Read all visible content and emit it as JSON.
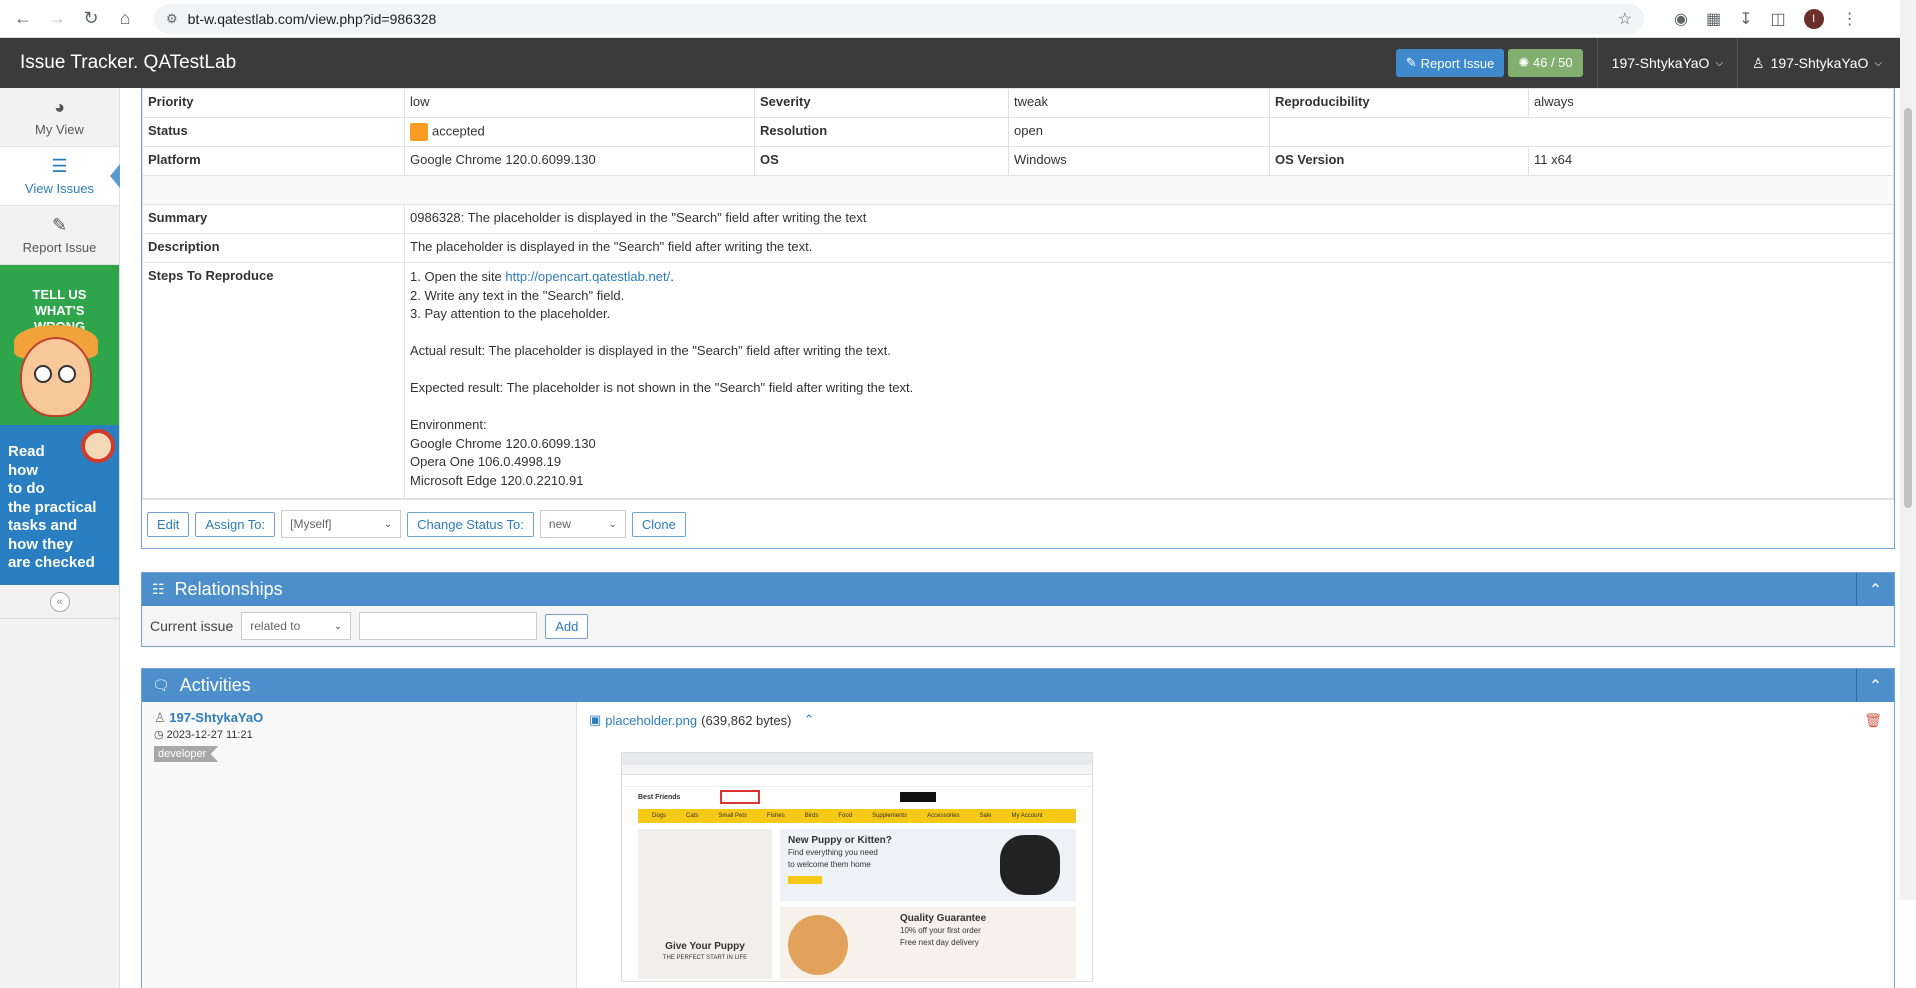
{
  "browser": {
    "url": "bt-w.qatestlab.com/view.php?id=986328",
    "avatar_letter": "I"
  },
  "header": {
    "app_title": "Issue Tracker. QATestLab",
    "report_label": "Report Issue",
    "count": "46 / 50",
    "user1": "197-ShtykaYaO",
    "user2": "197-ShtykaYaO"
  },
  "sidebar": {
    "items": [
      {
        "label": "My View",
        "icon": "dashboard-icon"
      },
      {
        "label": "View Issues",
        "icon": "list-icon"
      },
      {
        "label": "Report Issue",
        "icon": "edit-icon"
      }
    ],
    "banner_green": [
      "TELL US",
      "WHAT'S",
      "WRONG"
    ],
    "banner_blue": [
      "Read",
      "how",
      "to do",
      "the practical",
      "tasks and",
      "how they",
      "are checked"
    ]
  },
  "issue": {
    "priority_label": "Priority",
    "priority": "low",
    "severity_label": "Severity",
    "severity": "tweak",
    "reproducibility_label": "Reproducibility",
    "reproducibility": "always",
    "status_label": "Status",
    "status": "accepted",
    "resolution_label": "Resolution",
    "resolution": "open",
    "platform_label": "Platform",
    "platform": "Google Chrome 120.0.6099.130",
    "os_label": "OS",
    "os": "Windows",
    "os_version_label": "OS Version",
    "os_version": "11 x64",
    "summary_label": "Summary",
    "summary": "0986328: The placeholder is displayed in the \"Search\" field after writing the text",
    "description_label": "Description",
    "description": "The placeholder is displayed in the \"Search\" field after writing the text.",
    "steps_label": "Steps To Reproduce",
    "step1_prefix": "1. Open the site ",
    "step1_link": "http://opencart.qatestlab.net/",
    "step1_suffix": ".",
    "step2": "2. Write any text in the \"Search\" field.",
    "step3": "3. Pay attention to the placeholder.",
    "actual": "Actual result: The placeholder is displayed in the \"Search\" field after writing the text.",
    "expected": "Expected result: The placeholder is not shown in the \"Search\" field after writing the text.",
    "env_title": "Environment:",
    "env1": "Google Chrome 120.0.6099.130",
    "env2": "Opera One 106.0.4998.19",
    "env3": "Microsoft Edge 120.0.2210.91",
    "status_color": "#f99d22"
  },
  "actions": {
    "edit": "Edit",
    "assign": "Assign To:",
    "assign_value": "[Myself]",
    "change_status": "Change Status To:",
    "status_value": "new",
    "clone": "Clone"
  },
  "relationships": {
    "title": "Relationships",
    "current_issue": "Current issue",
    "relation_value": "related to",
    "add": "Add"
  },
  "activities": {
    "title": "Activities",
    "user": "197-ShtykaYaO",
    "date": "2023-12-27 11:21",
    "role": "developer",
    "file_name": "placeholder.png",
    "file_size": "(639,862 bytes)"
  },
  "thumbnail": {
    "brand": "Best Friends",
    "card1_title": "New Puppy or Kitten?",
    "card1_sub1": "Find everything you need",
    "card1_sub2": "to welcome them home",
    "card2_title": "Quality Guarantee",
    "card2_sub1": "10% off your first order",
    "card2_sub2": "Free next day delivery",
    "dog_title": "Give Your Puppy",
    "dog_sub": "THE PERFECT START IN LIFE",
    "nav": [
      "Dogs",
      "Cats",
      "Small Pets",
      "Fishes",
      "Birds",
      "Food",
      "Supplements",
      "Accessories",
      "Sale",
      "My Account"
    ]
  }
}
